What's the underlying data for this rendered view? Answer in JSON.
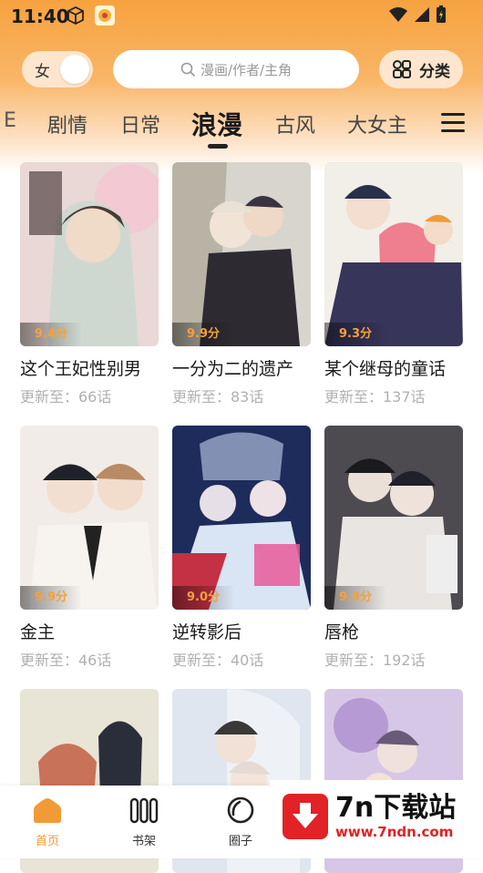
{
  "status": {
    "time": "11:40"
  },
  "header": {
    "gender_label": "女",
    "search_placeholder": "漫画/作者/主角",
    "category_label": "分类"
  },
  "tabs": [
    {
      "label": "E"
    },
    {
      "label": "剧情"
    },
    {
      "label": "日常"
    },
    {
      "label": "浪漫",
      "active": true
    },
    {
      "label": "古风"
    },
    {
      "label": "大女主"
    }
  ],
  "comics": [
    {
      "title": "这个王妃性别男",
      "update": "更新至：66话",
      "score": "9.4分"
    },
    {
      "title": "一分为二的遗产",
      "update": "更新至：83话",
      "score": "9.9分"
    },
    {
      "title": "某个继母的童话",
      "update": "更新至：137话",
      "score": "9.3分"
    },
    {
      "title": "金主",
      "update": "更新至：46话",
      "score": "9.9分"
    },
    {
      "title": "逆转影后",
      "update": "更新至：40话",
      "score": "9.0分"
    },
    {
      "title": "唇枪",
      "update": "更新至：192话",
      "score": "9.9分"
    },
    {
      "title": "",
      "update": "",
      "score": ""
    },
    {
      "title": "",
      "update": "",
      "score": ""
    },
    {
      "title": "",
      "update": "",
      "score": ""
    }
  ],
  "bottom_nav": [
    {
      "label": "首页",
      "icon": "home-icon",
      "active": true
    },
    {
      "label": "书架",
      "icon": "bookshelf-icon"
    },
    {
      "label": "圈子",
      "icon": "circle-icon"
    }
  ],
  "watermark": {
    "title": "7n下载站",
    "url": "www.7ndn.com"
  },
  "colors": {
    "accent": "#f29a35",
    "score": "#f6a03a",
    "header": "#f7a23f"
  }
}
